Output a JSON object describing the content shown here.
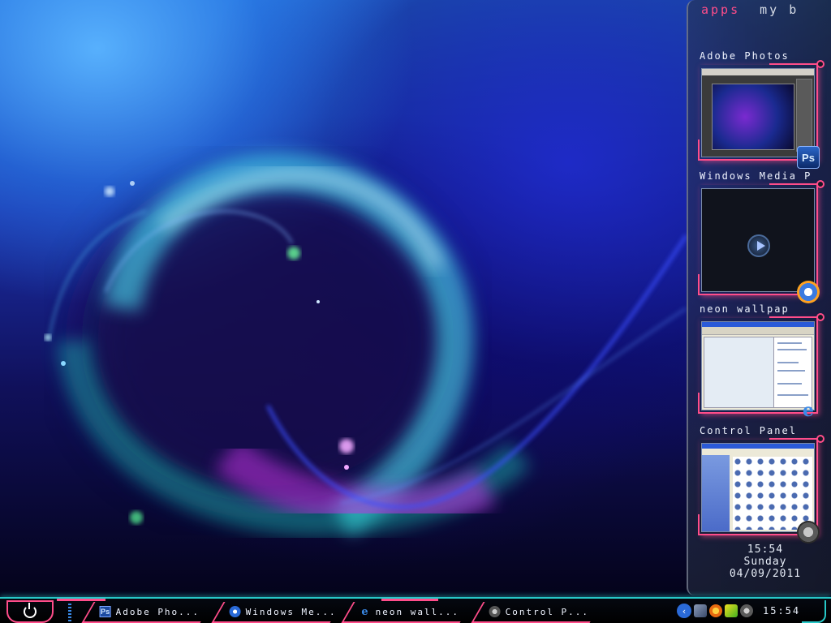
{
  "sidebar": {
    "tabs": [
      {
        "label": "apps",
        "active": true
      },
      {
        "label": "my b"
      }
    ],
    "apps": [
      {
        "title": "Adobe Photos",
        "icon": "photoshop-icon",
        "icon_text": "Ps"
      },
      {
        "title": "Windows Media P",
        "icon": "windows-media-player-icon"
      },
      {
        "title": "neon wallpap",
        "icon": "internet-explorer-icon",
        "icon_text": "e"
      },
      {
        "title": "Control Panel",
        "icon": "control-panel-icon"
      }
    ],
    "clock": {
      "time": "15:54",
      "day": "Sunday",
      "date": "04/09/2011"
    }
  },
  "taskbar": {
    "start_icon": "power-icon",
    "tasks": [
      {
        "label": "Adobe Pho...",
        "icon": "photoshop-icon",
        "icon_text": "Ps"
      },
      {
        "label": "Windows Me...",
        "icon": "windows-media-player-icon"
      },
      {
        "label": "neon wall...",
        "icon": "internet-explorer-icon",
        "icon_text": "e"
      },
      {
        "label": "Control P...",
        "icon": "control-panel-icon"
      }
    ],
    "tray_chevron": "‹",
    "clock": "15:54"
  },
  "colors": {
    "accent_pink": "#ff4d8a",
    "accent_cyan": "#27c8c8",
    "text": "#e8eef8"
  }
}
